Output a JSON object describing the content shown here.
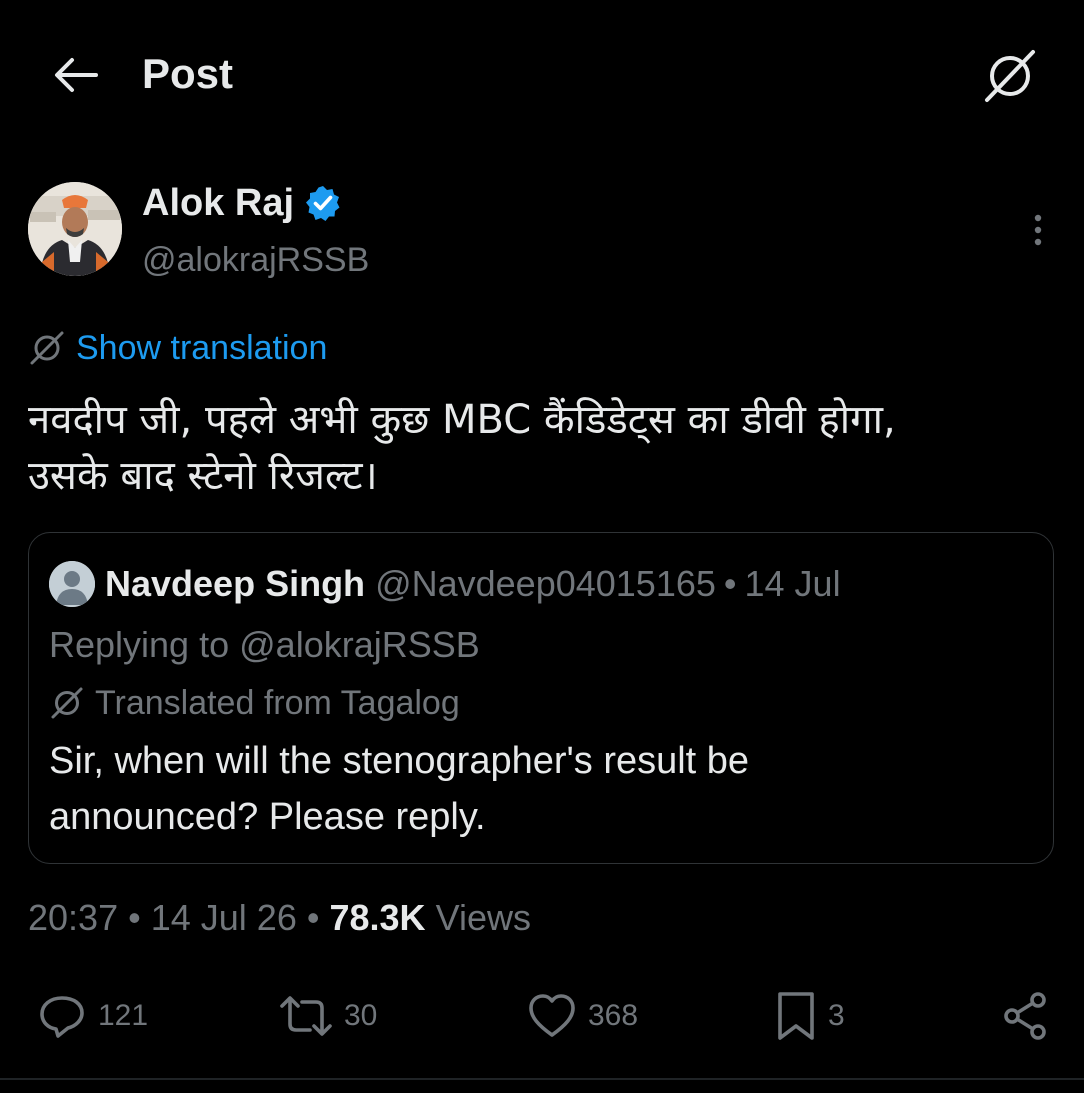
{
  "header": {
    "title": "Post"
  },
  "post": {
    "author": {
      "name": "Alok Raj",
      "handle": "@alokrajRSSB",
      "verified": true
    },
    "show_translation_label": "Show translation",
    "text_line1": "नवदीप जी, पहले अभी कुछ MBC कैंडिडेट्स का डीवी होगा,",
    "text_line2": "उसके बाद स्टेनो रिजल्ट।",
    "quote": {
      "name": "Navdeep Singh",
      "handle": "@Navdeep04015165",
      "separator": "•",
      "date": "14 Jul",
      "replying_prefix": "Replying to",
      "replying_mention": "@alokrajRSSB",
      "translated_label": "Translated from Tagalog",
      "text_line1": "Sir, when will the stenographer's result be",
      "text_line2": "announced? Please reply."
    },
    "meta": {
      "time": "20:37",
      "sep1": "•",
      "date": "14 Jul 26",
      "sep2": "•",
      "views_count": "78.3K",
      "views_label": "Views"
    },
    "actions": {
      "replies": "121",
      "reposts": "30",
      "likes": "368",
      "bookmarks": "3"
    }
  },
  "colors": {
    "background": "#000000",
    "text_primary": "#e7e9ea",
    "text_secondary": "#71767b",
    "accent": "#1d9bf0",
    "border": "#2f3336"
  },
  "icons": {
    "back": "arrow-left-icon",
    "translate": "translate-icon",
    "verified": "verified-badge-icon",
    "more": "more-vertical-icon",
    "reply": "reply-icon",
    "repost": "repost-icon",
    "like": "heart-icon",
    "bookmark": "bookmark-icon",
    "share": "share-icon"
  }
}
